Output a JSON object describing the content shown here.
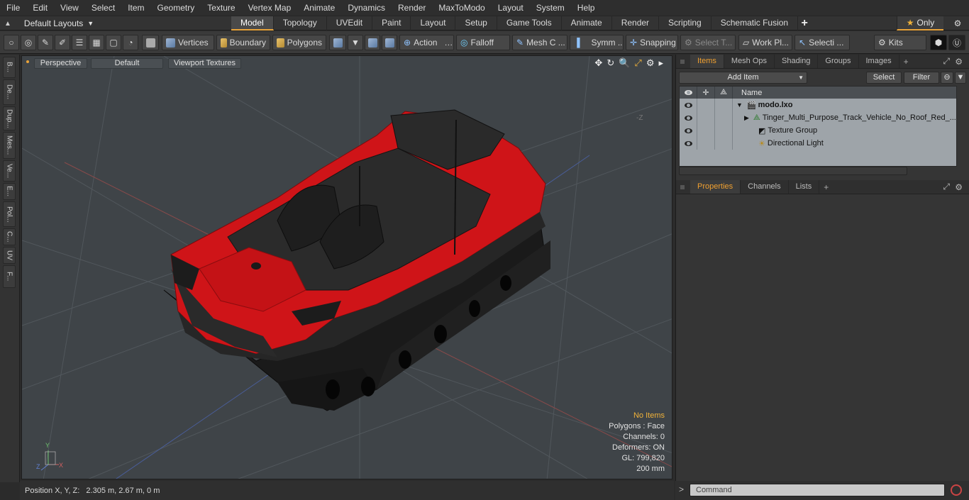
{
  "menu": [
    "File",
    "Edit",
    "View",
    "Select",
    "Item",
    "Geometry",
    "Texture",
    "Vertex Map",
    "Animate",
    "Dynamics",
    "Render",
    "MaxToModo",
    "Layout",
    "System",
    "Help"
  ],
  "layouts": {
    "label": "Default Layouts"
  },
  "tabs": [
    {
      "label": "Model",
      "active": true
    },
    {
      "label": "Topology"
    },
    {
      "label": "UVEdit"
    },
    {
      "label": "Paint"
    },
    {
      "label": "Layout"
    },
    {
      "label": "Setup"
    },
    {
      "label": "Game Tools"
    },
    {
      "label": "Animate"
    },
    {
      "label": "Render"
    },
    {
      "label": "Scripting"
    },
    {
      "label": "Schematic Fusion"
    }
  ],
  "only_label": "Only",
  "toolbar": {
    "vertices": "Vertices",
    "boundary": "Boundary",
    "polygons": "Polygons",
    "action": "Action",
    "falloff": "Falloff",
    "mesh": "Mesh C ...",
    "symm": "Symm ...",
    "snapping": "Snapping",
    "select_t": "Select T...",
    "work_pl": "Work Pl...",
    "selecti": "Selecti ...",
    "kits": "Kits"
  },
  "left_tabs": [
    "B...",
    "De...",
    "Dup...",
    "Mes...",
    "Ve...",
    "E...",
    "Pol...",
    "C...",
    "UV",
    "F..."
  ],
  "viewport": {
    "perspective": "Perspective",
    "default": "Default",
    "textures": "Viewport Textures",
    "stats": {
      "no_items": "No Items",
      "polygons": "Polygons : Face",
      "channels": "Channels: 0",
      "deformers": "Deformers: ON",
      "gl": "GL: 799,820",
      "size": "200 mm"
    }
  },
  "status": {
    "position": "Position X, Y, Z:   2.305 m, 2.67 m, 0 m"
  },
  "items_panel": {
    "tabs": [
      {
        "label": "Items",
        "active": true
      },
      {
        "label": "Mesh Ops"
      },
      {
        "label": "Shading"
      },
      {
        "label": "Groups"
      },
      {
        "label": "Images"
      }
    ],
    "add_item": "Add Item",
    "select": "Select",
    "filter": "Filter",
    "name_col": "Name",
    "rows": [
      {
        "label": "modo.lxo",
        "bold": true
      },
      {
        "label": "Tinger_Multi_Purpose_Track_Vehicle_No_Roof_Red_..."
      },
      {
        "label": "Texture Group"
      },
      {
        "label": "Directional Light"
      }
    ]
  },
  "props_panel": {
    "tabs": [
      {
        "label": "Properties",
        "active": true
      },
      {
        "label": "Channels"
      },
      {
        "label": "Lists"
      }
    ]
  },
  "command": {
    "placeholder": "Command"
  },
  "colors": {
    "accent": "#e8a33a",
    "vehicle_red": "#d8191c",
    "viewport_bg": "#3f4448"
  }
}
